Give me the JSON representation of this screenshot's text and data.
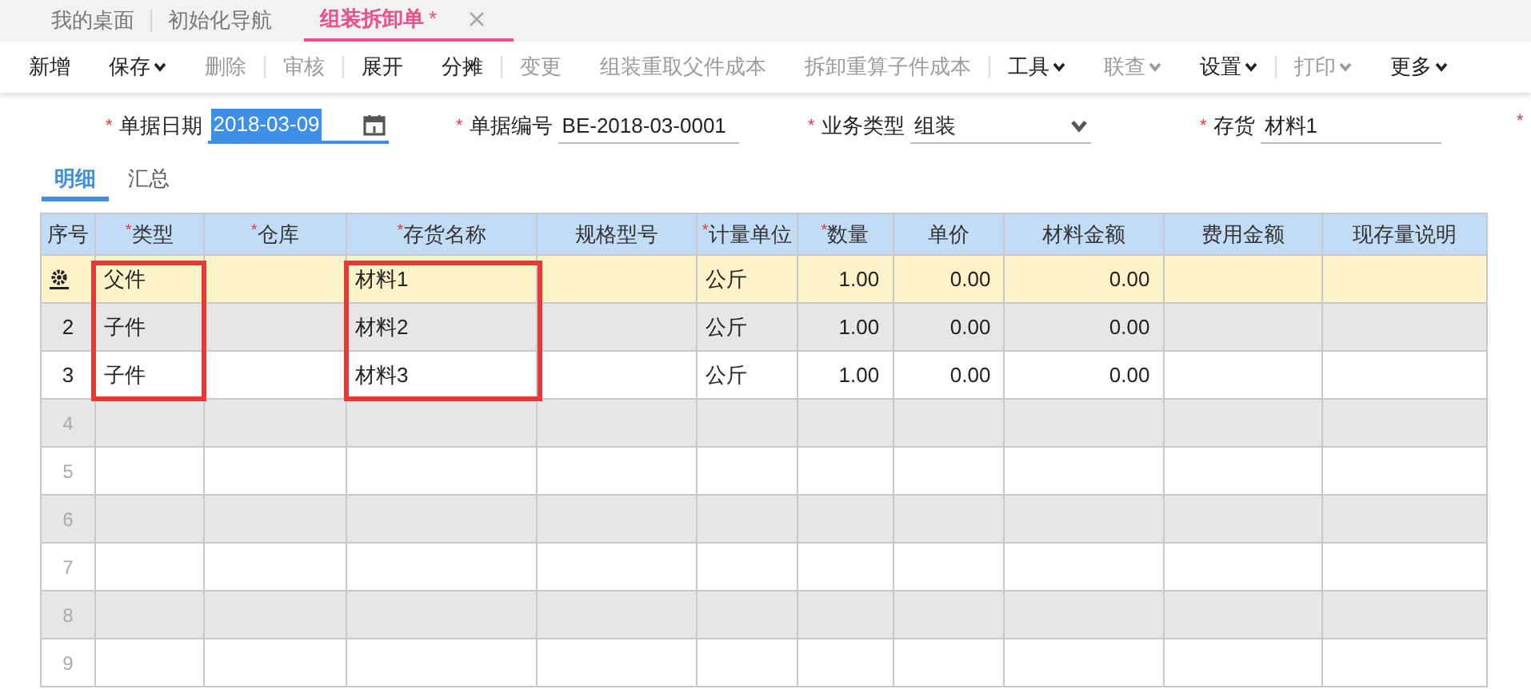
{
  "tabs": [
    {
      "label": "我的桌面",
      "selected": false,
      "closable": false
    },
    {
      "label": "初始化导航",
      "selected": false,
      "closable": false
    },
    {
      "label": "组装拆卸单",
      "selected": true,
      "modified_mark": "*",
      "closable": true
    }
  ],
  "toolbar": [
    {
      "kind": "button",
      "label": "新增",
      "disabled": false,
      "dropdown": false
    },
    {
      "kind": "button",
      "label": "保存",
      "disabled": false,
      "dropdown": true
    },
    {
      "kind": "button",
      "label": "删除",
      "disabled": true,
      "dropdown": false
    },
    {
      "kind": "divider"
    },
    {
      "kind": "button",
      "label": "审核",
      "disabled": true,
      "dropdown": false
    },
    {
      "kind": "divider"
    },
    {
      "kind": "button",
      "label": "展开",
      "disabled": false,
      "dropdown": false
    },
    {
      "kind": "button",
      "label": "分摊",
      "disabled": false,
      "dropdown": false
    },
    {
      "kind": "divider"
    },
    {
      "kind": "button",
      "label": "变更",
      "disabled": true,
      "dropdown": false
    },
    {
      "kind": "button",
      "label": "组装重取父件成本",
      "disabled": true,
      "dropdown": false
    },
    {
      "kind": "button",
      "label": "拆卸重算子件成本",
      "disabled": true,
      "dropdown": false
    },
    {
      "kind": "divider"
    },
    {
      "kind": "button",
      "label": "工具",
      "disabled": false,
      "dropdown": true
    },
    {
      "kind": "button",
      "label": "联查",
      "disabled": true,
      "dropdown": true
    },
    {
      "kind": "button",
      "label": "设置",
      "disabled": false,
      "dropdown": true
    },
    {
      "kind": "divider"
    },
    {
      "kind": "button",
      "label": "打印",
      "disabled": true,
      "dropdown": true
    },
    {
      "kind": "button",
      "label": "更多",
      "disabled": false,
      "dropdown": true
    }
  ],
  "fields": [
    {
      "kind": "date",
      "required_mark": "*",
      "label": "单据日期",
      "value": "2018-03-09",
      "focused": true
    },
    {
      "kind": "text",
      "required_mark": "*",
      "label": "单据编号",
      "value": "BE-2018-03-0001",
      "focused": false
    },
    {
      "kind": "select",
      "required_mark": "*",
      "label": "业务类型",
      "value": "组装",
      "focused": false
    },
    {
      "kind": "text",
      "required_mark": "*",
      "label": "存货",
      "value": "材料1",
      "focused": false
    },
    {
      "kind": "cut",
      "required_mark": "*"
    }
  ],
  "subtabs": [
    {
      "label": "明细",
      "selected": true
    },
    {
      "label": "汇总",
      "selected": false
    }
  ],
  "table": {
    "columns": [
      {
        "label": "序号",
        "highlighted": false
      },
      {
        "required_mark": "*",
        "label": "类型",
        "highlighted": true
      },
      {
        "required_mark": "*",
        "label": "仓库",
        "highlighted": false
      },
      {
        "required_mark": "*",
        "label": "存货名称",
        "highlighted": true
      },
      {
        "label": "规格型号",
        "highlighted": false
      },
      {
        "required_mark": "*",
        "label": "计量单位",
        "highlighted": false
      },
      {
        "required_mark": "*",
        "label": "数量",
        "highlighted": false
      },
      {
        "label": "单价",
        "highlighted": false
      },
      {
        "label": "材料金额",
        "highlighted": false
      },
      {
        "label": "费用金额",
        "highlighted": false
      },
      {
        "label": "现存量说明",
        "highlighted": false
      }
    ],
    "rows": [
      {
        "selected": true,
        "cells": [
          "",
          "父件",
          "",
          "材料1",
          "",
          "公斤",
          "1.00",
          "0.00",
          "0.00",
          "",
          ""
        ]
      },
      {
        "selected": false,
        "cells": [
          "2",
          "子件",
          "",
          "材料2",
          "",
          "公斤",
          "1.00",
          "0.00",
          "0.00",
          "",
          ""
        ]
      },
      {
        "selected": false,
        "cells": [
          "3",
          "子件",
          "",
          "材料3",
          "",
          "公斤",
          "1.00",
          "0.00",
          "0.00",
          "",
          ""
        ]
      },
      {
        "selected": false,
        "cells": [
          "4"
        ]
      },
      {
        "selected": false,
        "cells": [
          "5"
        ]
      },
      {
        "selected": false,
        "cells": [
          "6"
        ]
      },
      {
        "selected": false,
        "cells": [
          "7"
        ]
      },
      {
        "selected": false,
        "cells": [
          "8"
        ]
      },
      {
        "selected": false,
        "cells": [
          "9"
        ]
      }
    ]
  }
}
